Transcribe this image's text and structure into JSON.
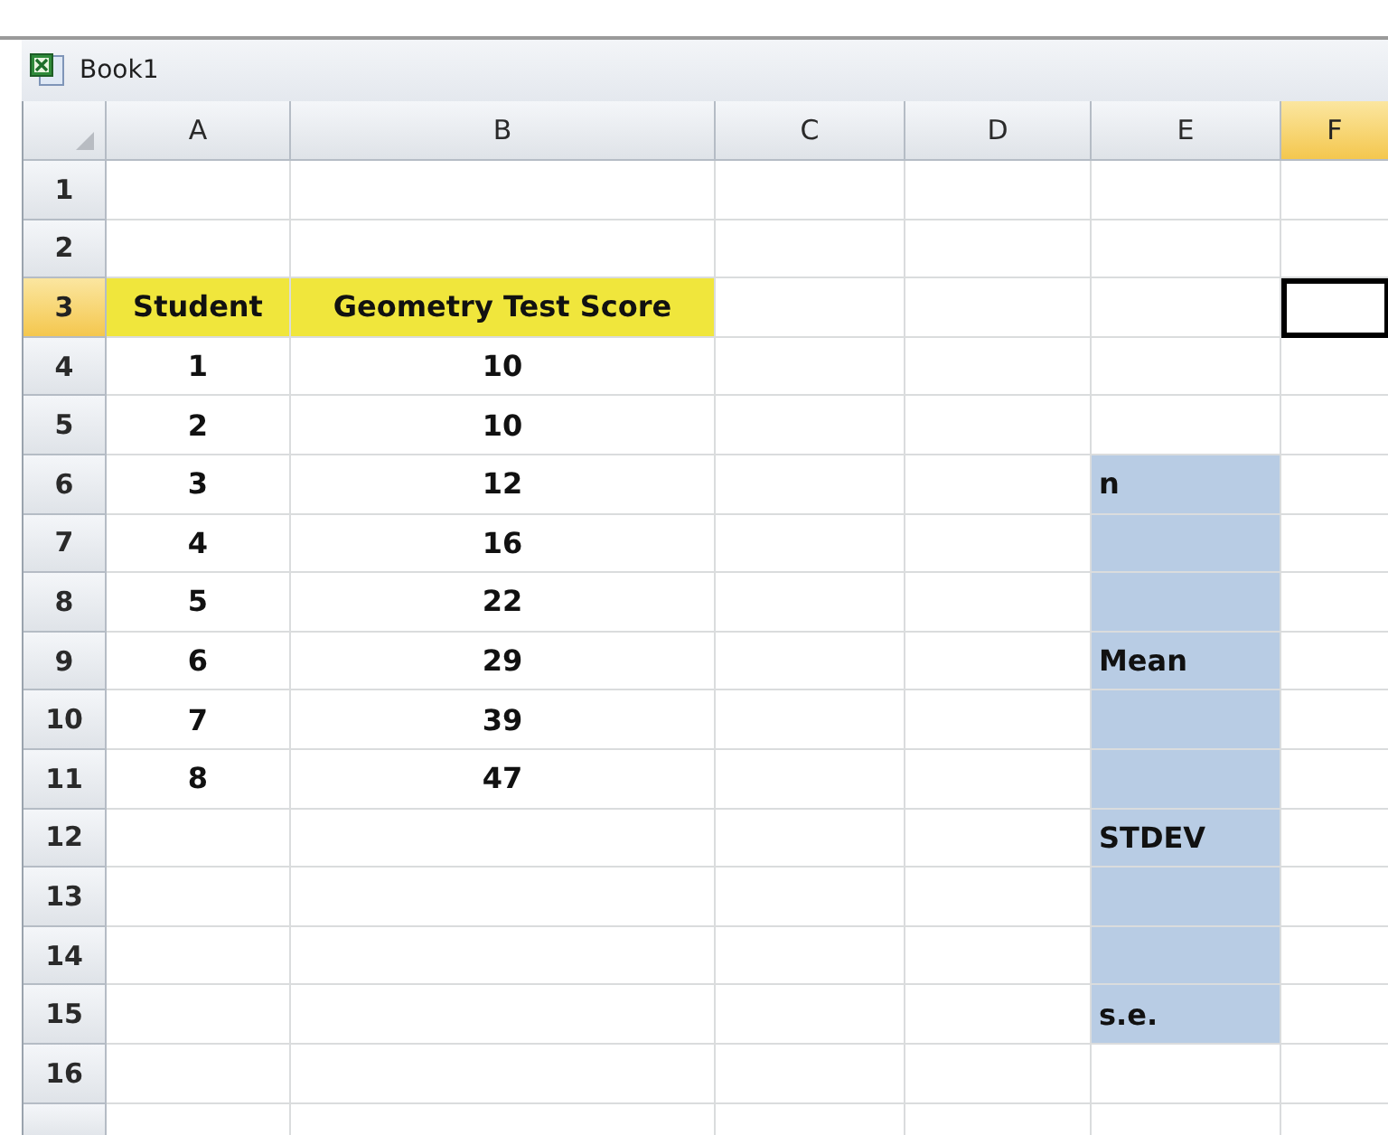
{
  "window": {
    "title": "Book1"
  },
  "columns": [
    {
      "label": "A",
      "selected": false
    },
    {
      "label": "B",
      "selected": false
    },
    {
      "label": "C",
      "selected": false
    },
    {
      "label": "D",
      "selected": false
    },
    {
      "label": "E",
      "selected": false
    },
    {
      "label": "F",
      "selected": true
    }
  ],
  "rows": [
    {
      "label": "1",
      "selected": false,
      "cells": [
        {
          "text": "",
          "selected": false
        },
        {
          "text": "",
          "selected": false
        },
        {
          "text": "",
          "selected": false
        },
        {
          "text": "",
          "selected": false
        },
        {
          "text": "",
          "selected": false
        },
        {
          "text": "",
          "selected": false
        }
      ]
    },
    {
      "label": "2",
      "selected": false,
      "cells": [
        {
          "text": "",
          "selected": false
        },
        {
          "text": "",
          "selected": false
        },
        {
          "text": "",
          "selected": false
        },
        {
          "text": "",
          "selected": false
        },
        {
          "text": "",
          "selected": false
        },
        {
          "text": "",
          "selected": false
        }
      ]
    },
    {
      "label": "3",
      "selected": true,
      "cells": [
        {
          "text": "Student",
          "color": "#f0e63c",
          "selected": false
        },
        {
          "text": "Geometry Test Score",
          "color": "#f0e63c",
          "selected": false
        },
        {
          "text": "",
          "selected": false
        },
        {
          "text": "",
          "selected": false
        },
        {
          "text": "",
          "selected": false
        },
        {
          "text": "",
          "selected": true
        }
      ]
    },
    {
      "label": "4",
      "selected": false,
      "cells": [
        {
          "text": "1",
          "selected": false
        },
        {
          "text": "10",
          "selected": false
        },
        {
          "text": "",
          "selected": false
        },
        {
          "text": "",
          "selected": false
        },
        {
          "text": "",
          "selected": false
        },
        {
          "text": "",
          "selected": false
        }
      ]
    },
    {
      "label": "5",
      "selected": false,
      "cells": [
        {
          "text": "2",
          "selected": false
        },
        {
          "text": "10",
          "selected": false
        },
        {
          "text": "",
          "selected": false
        },
        {
          "text": "",
          "selected": false
        },
        {
          "text": "",
          "selected": false
        },
        {
          "text": "",
          "selected": false
        }
      ]
    },
    {
      "label": "6",
      "selected": false,
      "cells": [
        {
          "text": "3",
          "selected": false
        },
        {
          "text": "12",
          "selected": false
        },
        {
          "text": "",
          "selected": false
        },
        {
          "text": "",
          "selected": false
        },
        {
          "text": "n",
          "color": "#b8cce4",
          "selected": false
        },
        {
          "text": "",
          "selected": false
        }
      ]
    },
    {
      "label": "7",
      "selected": false,
      "cells": [
        {
          "text": "4",
          "selected": false
        },
        {
          "text": "16",
          "selected": false
        },
        {
          "text": "",
          "selected": false
        },
        {
          "text": "",
          "selected": false
        },
        {
          "text": "",
          "color": "#b8cce4",
          "selected": false
        },
        {
          "text": "",
          "selected": false
        }
      ]
    },
    {
      "label": "8",
      "selected": false,
      "cells": [
        {
          "text": "5",
          "selected": false
        },
        {
          "text": "22",
          "selected": false
        },
        {
          "text": "",
          "selected": false
        },
        {
          "text": "",
          "selected": false
        },
        {
          "text": "",
          "color": "#b8cce4",
          "selected": false
        },
        {
          "text": "",
          "selected": false
        }
      ]
    },
    {
      "label": "9",
      "selected": false,
      "cells": [
        {
          "text": "6",
          "selected": false
        },
        {
          "text": "29",
          "selected": false
        },
        {
          "text": "",
          "selected": false
        },
        {
          "text": "",
          "selected": false
        },
        {
          "text": "Mean",
          "color": "#b8cce4",
          "selected": false
        },
        {
          "text": "",
          "selected": false
        }
      ]
    },
    {
      "label": "10",
      "selected": false,
      "cells": [
        {
          "text": "7",
          "selected": false
        },
        {
          "text": "39",
          "selected": false
        },
        {
          "text": "",
          "selected": false
        },
        {
          "text": "",
          "selected": false
        },
        {
          "text": "",
          "color": "#b8cce4",
          "selected": false
        },
        {
          "text": "",
          "selected": false
        }
      ]
    },
    {
      "label": "11",
      "selected": false,
      "cells": [
        {
          "text": "8",
          "selected": false
        },
        {
          "text": "47",
          "selected": false
        },
        {
          "text": "",
          "selected": false
        },
        {
          "text": "",
          "selected": false
        },
        {
          "text": "",
          "color": "#b8cce4",
          "selected": false
        },
        {
          "text": "",
          "selected": false
        }
      ]
    },
    {
      "label": "12",
      "selected": false,
      "cells": [
        {
          "text": "",
          "selected": false
        },
        {
          "text": "",
          "selected": false
        },
        {
          "text": "",
          "selected": false
        },
        {
          "text": "",
          "selected": false
        },
        {
          "text": "STDEV",
          "color": "#b8cce4",
          "selected": false
        },
        {
          "text": "",
          "selected": false
        }
      ]
    },
    {
      "label": "13",
      "selected": false,
      "cells": [
        {
          "text": "",
          "selected": false
        },
        {
          "text": "",
          "selected": false
        },
        {
          "text": "",
          "selected": false
        },
        {
          "text": "",
          "selected": false
        },
        {
          "text": "",
          "color": "#b8cce4",
          "selected": false
        },
        {
          "text": "",
          "selected": false
        }
      ]
    },
    {
      "label": "14",
      "selected": false,
      "cells": [
        {
          "text": "",
          "selected": false
        },
        {
          "text": "",
          "selected": false
        },
        {
          "text": "",
          "selected": false
        },
        {
          "text": "",
          "selected": false
        },
        {
          "text": "",
          "color": "#b8cce4",
          "selected": false
        },
        {
          "text": "",
          "selected": false
        }
      ]
    },
    {
      "label": "15",
      "selected": false,
      "cells": [
        {
          "text": "",
          "selected": false
        },
        {
          "text": "",
          "selected": false
        },
        {
          "text": "",
          "selected": false
        },
        {
          "text": "",
          "selected": false
        },
        {
          "text": "s.e.",
          "color": "#b8cce4",
          "selected": false
        },
        {
          "text": "",
          "selected": false
        }
      ]
    },
    {
      "label": "16",
      "selected": false,
      "cells": [
        {
          "text": "",
          "selected": false
        },
        {
          "text": "",
          "selected": false
        },
        {
          "text": "",
          "selected": false
        },
        {
          "text": "",
          "selected": false
        },
        {
          "text": "",
          "selected": false
        },
        {
          "text": "",
          "selected": false
        }
      ]
    }
  ]
}
